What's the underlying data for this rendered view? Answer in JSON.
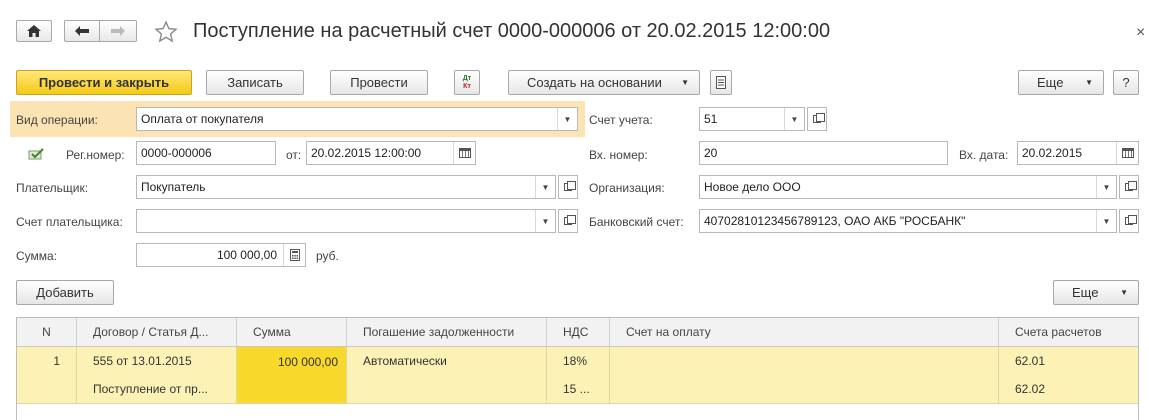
{
  "window": {
    "title": "Поступление на расчетный счет 0000-000006 от 20.02.2015 12:00:00"
  },
  "toolbar": {
    "post_close": "Провести и закрыть",
    "save": "Записать",
    "post": "Провести",
    "dtkt_top": "Дт",
    "dtkt_bottom": "Кт",
    "create_based": "Создать на основании",
    "more": "Еще",
    "help": "?"
  },
  "form": {
    "op_type_label": "Вид операции:",
    "op_type_value": "Оплата от покупателя",
    "account_label": "Счет учета:",
    "account_value": "51",
    "reg_label": "Рег.номер:",
    "reg_value": "0000-000006",
    "from_label": "от:",
    "from_value": "20.02.2015 12:00:00",
    "in_num_label": "Вх. номер:",
    "in_num_value": "20",
    "in_date_label": "Вх. дата:",
    "in_date_value": "20.02.2015",
    "payer_label": "Плательщик:",
    "payer_value": "Покупатель",
    "org_label": "Организация:",
    "org_value": "Новое дело ООО",
    "payer_acc_label": "Счет плательщика:",
    "payer_acc_value": "",
    "bank_label": "Банковский счет:",
    "bank_value": "40702810123456789123, ОАО АКБ \"РОСБАНК\"",
    "sum_label": "Сумма:",
    "sum_value": "100 000,00",
    "currency": "руб."
  },
  "table_toolbar": {
    "add": "Добавить",
    "more": "Еще"
  },
  "table": {
    "headers": [
      "N",
      "Договор / Статья Д...",
      "Сумма",
      "Погашение задолженности",
      "НДС",
      "Счет на оплату",
      "Счета расчетов"
    ],
    "row1": [
      "1",
      "555 от 13.01.2015",
      "100 000,00",
      "Автоматически",
      "18%",
      "",
      "62.01"
    ],
    "row2": [
      "",
      "Поступление от пр...",
      "",
      "",
      "15 ...",
      "",
      "62.02"
    ]
  },
  "colors": {
    "accent_yellow": "#f5c915",
    "row_highlight": "#fcf2b6",
    "cell_selected": "#f8d82a",
    "field_highlight": "#fbe3b4"
  }
}
